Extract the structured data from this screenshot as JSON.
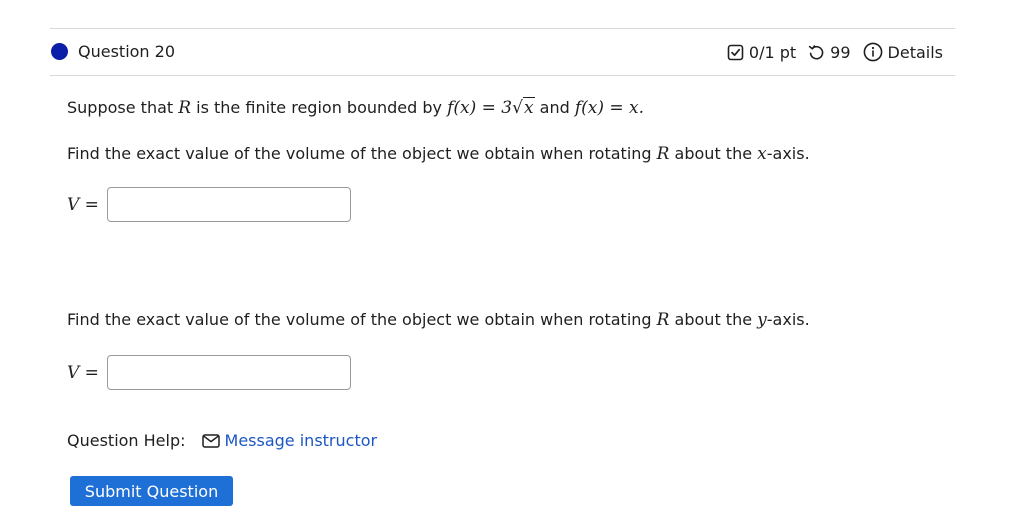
{
  "question": {
    "title": "Question 20",
    "score": "0/1 pt",
    "retries": "99",
    "details_label": "Details"
  },
  "problem": {
    "line1_prefix": "Suppose that ",
    "line1_region": "R",
    "line1_mid": " is the finite region bounded by ",
    "f1_lhs": "f(x) = 3",
    "f1_radicand": "x",
    "line1_and": " and ",
    "f2": "f(x) = x.",
    "part1_prefix": "Find the exact value of the volume of the object we obtain when rotating ",
    "part1_region": "R",
    "part1_mid": " about the ",
    "part1_axis": "x",
    "part1_suffix": "-axis.",
    "part2_prefix": "Find the exact value of the volume of the object we obtain when rotating ",
    "part2_region": "R",
    "part2_mid": " about the ",
    "part2_axis": "y",
    "part2_suffix": "-axis."
  },
  "answers": [
    {
      "var": "V",
      "eq": " =",
      "value": ""
    },
    {
      "var": "V",
      "eq": " =",
      "value": ""
    }
  ],
  "help": {
    "label": "Question Help:",
    "message_link": "Message instructor"
  },
  "submit_label": "Submit Question",
  "colors": {
    "dot": "#0b1fa8",
    "link": "#1b57c6",
    "submit_bg": "#1e6fd6"
  },
  "icons": [
    "score-check-icon",
    "retry-icon",
    "info-icon",
    "mail-icon"
  ]
}
